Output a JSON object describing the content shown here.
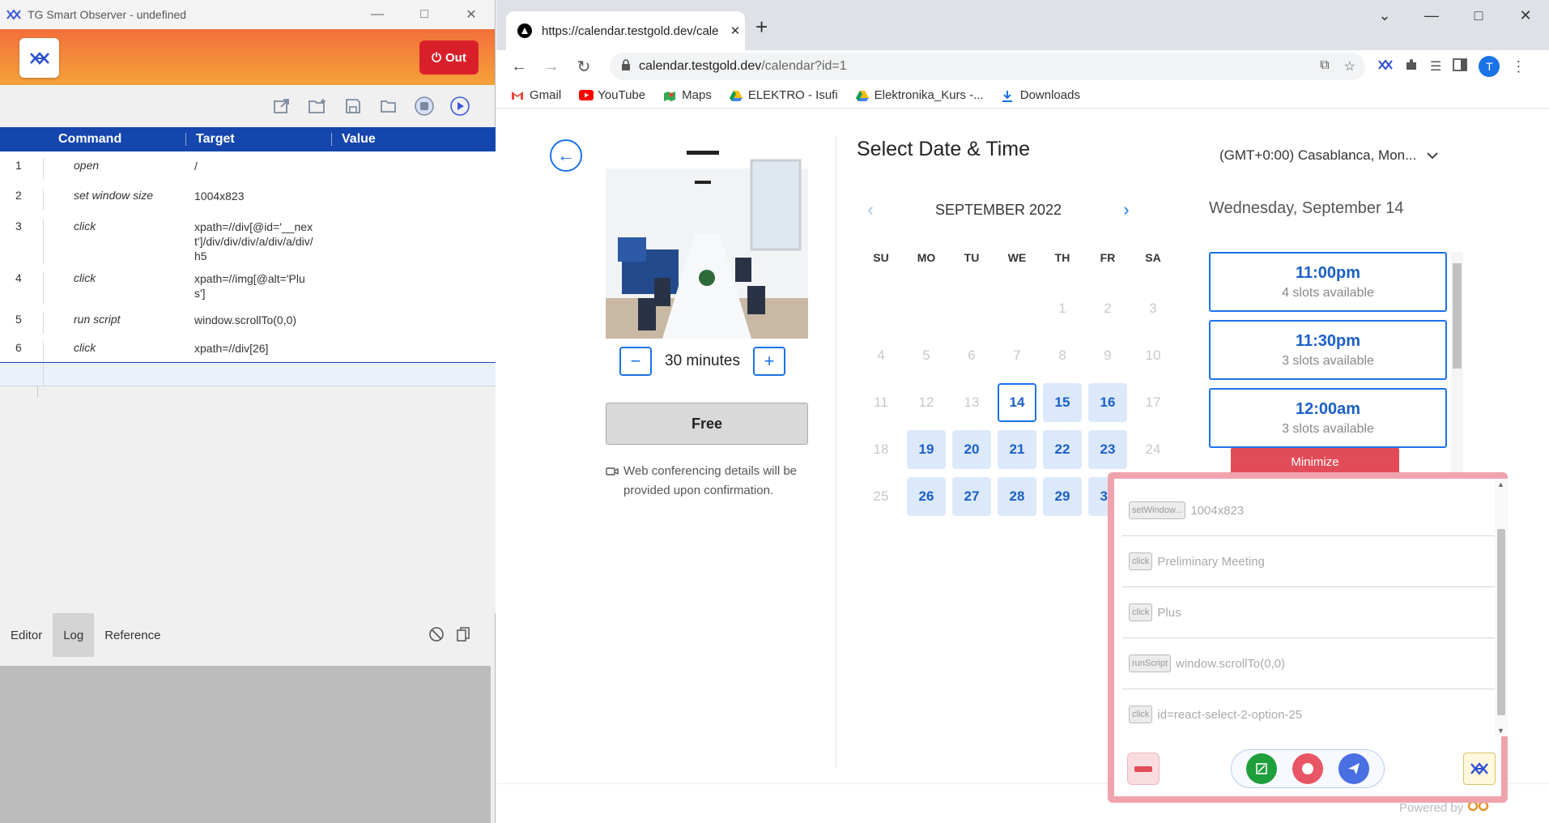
{
  "observer": {
    "window_title": "TG Smart Observer - undefined",
    "out_label": "Out",
    "columns": {
      "command": "Command",
      "target": "Target",
      "value": "Value"
    },
    "rows": [
      {
        "num": "1",
        "command": "open",
        "target": "/",
        "value": ""
      },
      {
        "num": "2",
        "command": "set window size",
        "target": "1004x823",
        "value": ""
      },
      {
        "num": "3",
        "command": "click",
        "target": "xpath=//div[@id='__next']/div/div/div/a/div/a/div/h5",
        "value": ""
      },
      {
        "num": "4",
        "command": "click",
        "target": "xpath=//img[@alt='Plus']",
        "value": ""
      },
      {
        "num": "5",
        "command": "run script",
        "target": "window.scrollTo(0,0)",
        "value": ""
      },
      {
        "num": "6",
        "command": "click",
        "target": "xpath=//div[26]",
        "value": ""
      }
    ],
    "tabs": {
      "editor": "Editor",
      "log": "Log",
      "reference": "Reference"
    },
    "toolbar_icons": [
      "export-icon",
      "new-folder-icon",
      "save-icon",
      "open-folder-icon",
      "record-icon",
      "play-icon"
    ]
  },
  "browser": {
    "tab_title": "https://calendar.testgold.dev/cale",
    "url_host": "calendar.testgold.dev",
    "url_path": "/calendar?id=1",
    "profile_initial": "T",
    "bookmarks": [
      "Gmail",
      "YouTube",
      "Maps",
      "ELEKTRO - Isufi",
      "Elektronika_Kurs -...",
      "Downloads"
    ]
  },
  "page": {
    "duration": "30 minutes",
    "free_label": "Free",
    "web_conf": "Web conferencing details will be\nprovided upon confirmation.",
    "select_title": "Select Date & Time",
    "timezone": "(GMT+0:00) Casablanca, Mon...",
    "month": "SEPTEMBER 2022",
    "weekdays": [
      "SU",
      "MO",
      "TU",
      "WE",
      "TH",
      "FR",
      "SA"
    ],
    "weeks": [
      [
        null,
        null,
        null,
        null,
        "1",
        "2",
        "3"
      ],
      [
        "4",
        "5",
        "6",
        "7",
        "8",
        "9",
        "10"
      ],
      [
        "11",
        "12",
        "13",
        "14",
        "15",
        "16",
        "17"
      ],
      [
        "18",
        "19",
        "20",
        "21",
        "22",
        "23",
        "24"
      ],
      [
        "25",
        "26",
        "27",
        "28",
        "29",
        "30",
        null
      ]
    ],
    "available_days": [
      "14",
      "15",
      "16",
      "19",
      "20",
      "21",
      "22",
      "23",
      "26",
      "27",
      "28",
      "29",
      "30"
    ],
    "selected_day": "14",
    "date_heading": "Wednesday, September 14",
    "slots": [
      {
        "time": "11:00pm",
        "avail": "4 slots available"
      },
      {
        "time": "11:30pm",
        "avail": "3 slots available"
      },
      {
        "time": "12:00am",
        "avail": "3 slots available"
      }
    ],
    "powered_by": "Powered by"
  },
  "recorder": {
    "minimize_label": "Minimize",
    "steps": [
      {
        "badge": "setWindow...",
        "text": "1004x823"
      },
      {
        "badge": "click",
        "text": "Preliminary Meeting"
      },
      {
        "badge": "click",
        "text": "Plus"
      },
      {
        "badge": "runScript",
        "text": "window.scrollTo(0,0)"
      },
      {
        "badge": "click",
        "text": "id=react-select-2-option-25"
      }
    ]
  },
  "colors": {
    "accent_blue": "#1a73e8",
    "header_blue": "#1546ae",
    "out_red": "#d9202a",
    "recorder_border": "#f0a3ad"
  }
}
